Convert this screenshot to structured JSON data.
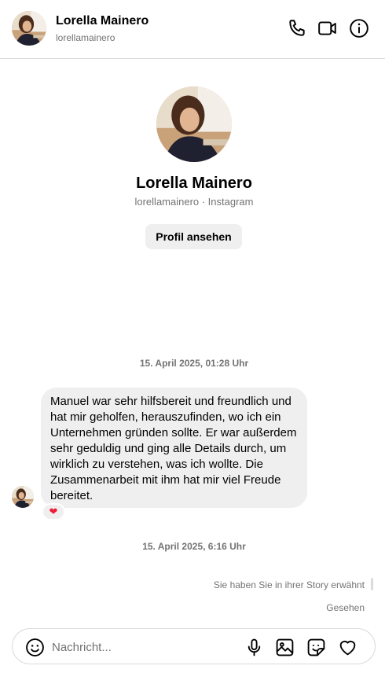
{
  "header": {
    "name": "Lorella Mainero",
    "handle": "lorellamainero",
    "icons": [
      "phone-icon",
      "video-call-icon",
      "info-icon"
    ]
  },
  "profile": {
    "name": "Lorella Mainero",
    "subtitle": "lorellamainero · Instagram",
    "button_label": "Profil ansehen"
  },
  "thread": {
    "timestamp_1": "15. April 2025, 01:28 Uhr",
    "message_lines": [
      "Manuel war sehr hilfsbereit und freundlich und",
      "hat mir geholfen, herauszufinden, wo ich ein",
      "Unternehmen gründen sollte. Er war außerdem",
      "sehr geduldig und ging alle Details durch, um",
      "wirklich zu verstehen, was ich wollte. Die",
      "Zusammenarbeit mit ihm hat mir viel Freude",
      "bereitet."
    ],
    "reaction": "❤",
    "timestamp_2": "15. April 2025, 6:16 Uhr",
    "story_note": "Sie haben Sie in ihrer Story erwähnt",
    "seen": "Gesehen"
  },
  "composer": {
    "placeholder": "Nachricht...",
    "icons": [
      "emoji-icon",
      "microphone-icon",
      "image-icon",
      "sticker-icon",
      "heart-icon"
    ]
  },
  "colors": {
    "secondary_text": "#737373",
    "bubble_bg": "#efefef",
    "border": "#dbdbdb",
    "reaction_red": "#ed1c3b"
  }
}
